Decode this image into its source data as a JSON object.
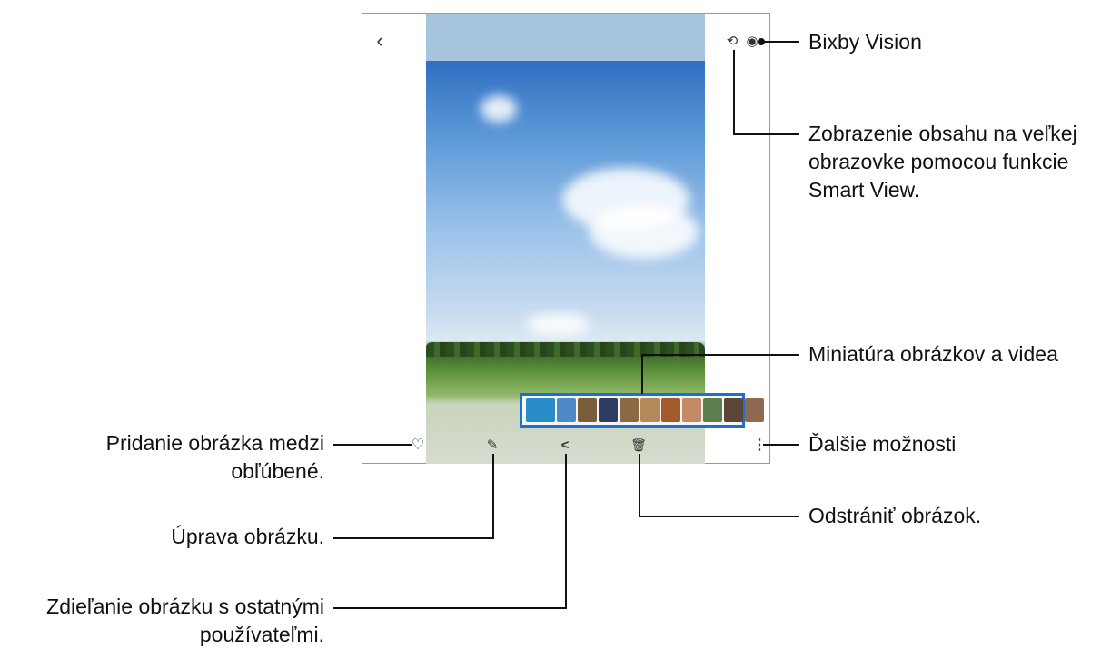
{
  "callouts": {
    "bixby": "Bixby Vision",
    "smartview": "Zobrazenie obsahu na veľkej\nobrazovke pomocou funkcie\nSmart View.",
    "thumbnails": "Miniatúra obrázkov a videa",
    "favorite": "Pridanie obrázka medzi\nobľúbené.",
    "more": "Ďalšie možnosti",
    "delete": "Odstrániť obrázok.",
    "edit": "Úprava obrázku.",
    "share": "Zdieľanie obrázku s ostatnými\npoužívateľmi."
  },
  "icons": {
    "back": "‹",
    "smartview": "⟲",
    "bixby": "◉",
    "favorite": "♡",
    "edit": "✎",
    "share": "<",
    "delete": "🗑",
    "more": "⋮"
  },
  "thumbnail_colors": [
    "#2a8bc9",
    "#4d88c7",
    "#7a5e3c",
    "#2f3d63",
    "#8a6a45",
    "#b48a5a",
    "#a35a2a",
    "#c48a65",
    "#5b7f4c",
    "#5a4536",
    "#8d6a4f"
  ]
}
